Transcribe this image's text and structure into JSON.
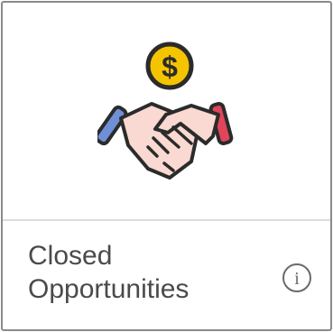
{
  "tile": {
    "title_lines": [
      "Closed",
      "Opportunities"
    ],
    "icon": "handshake-dollar-icon",
    "info_icon": "info-icon",
    "info_glyph": "i",
    "coin_glyph": "$"
  },
  "colors": {
    "coin": "#f5c400",
    "coin_outline": "#2b2b2b",
    "hand": "#f9d9d1",
    "left_cuff": "#6f8fd6",
    "right_cuff": "#e0455a",
    "text": "#4a4a4a",
    "border": "#8a8a8a",
    "divider": "#dcdcdc"
  }
}
